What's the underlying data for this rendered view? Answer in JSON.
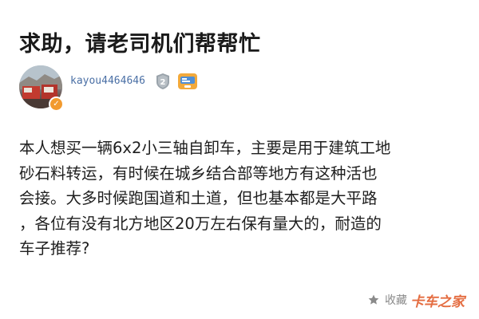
{
  "post": {
    "title": "求助，请老司机们帮帮忙"
  },
  "author": {
    "username": "kayou4464646",
    "level": "2",
    "avatar_badge": "✓"
  },
  "content": {
    "lines": [
      "本人想买一辆6x2小三轴自卸车，主要是用于建筑工地",
      "砂石料转运，有时候在城乡结合部等地方有这种活也",
      "会接。大多时候跑国道和土道，但也基本都是大平路",
      "，各位有没有北方地区20万左右保有量大的，耐造的",
      "车子推荐?"
    ]
  },
  "footer": {
    "collect_label": "收藏",
    "watermark": "卡车之家"
  },
  "icons": {
    "avatar_badge": "check-badge-icon",
    "level": "level-shield-icon",
    "medal": "medal-badge-icon",
    "collect": "star-icon"
  },
  "colors": {
    "username": "#4a6fa5",
    "avatar_badge": "#f29a2e",
    "medal": "#f2a93b",
    "watermark": "#e0531f",
    "collect": "#8a8a8a"
  }
}
